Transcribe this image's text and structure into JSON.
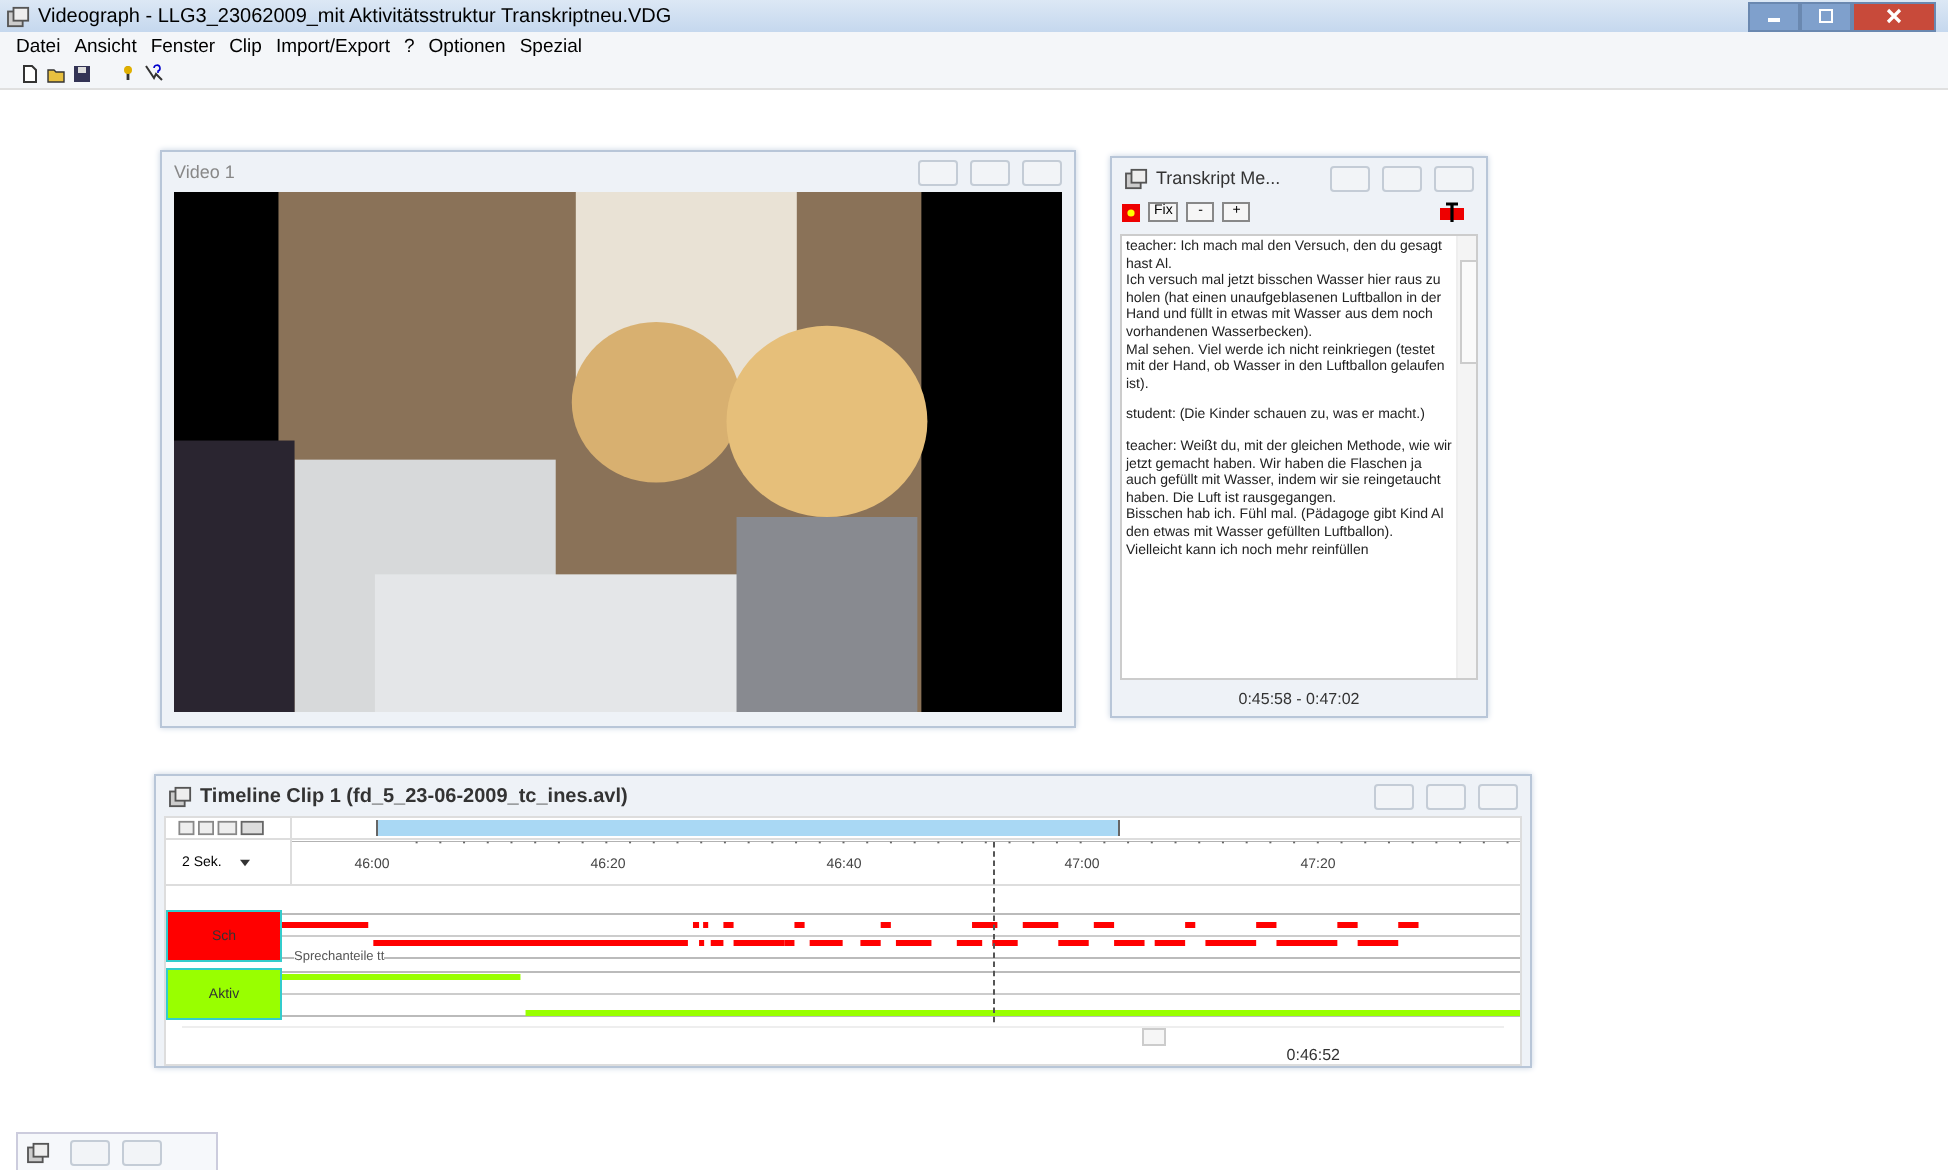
{
  "window": {
    "title": "Videograph - LLG3_23062009_mit Aktivitätsstruktur Transkriptneu.VDG"
  },
  "menu": [
    "Datei",
    "Ansicht",
    "Fenster",
    "Clip",
    "Import/Export",
    "?",
    "Optionen",
    "Spezial"
  ],
  "video_window": {
    "title": "Video 1"
  },
  "transcript_window": {
    "title": "Transkript Me...",
    "fix_button": "Fix",
    "minus_button": "-",
    "plus_button": "+",
    "paragraphs": [
      "teacher: Ich mach mal den Versuch, den du gesagt hast Al.\nIch versuch mal jetzt bisschen Wasser hier raus zu holen (hat einen unaufgeblasenen Luftballon in der Hand und füllt in etwas mit Wasser aus dem noch vorhandenen Wasserbecken).\nMal sehen. Viel werde ich nicht reinkriegen (testet mit der Hand, ob Wasser in den Luftballon gelaufen ist).",
      "student: (Die Kinder schauen zu, was er macht.)",
      "teacher: Weißt du, mit der gleichen Methode, wie wir jetzt gemacht haben. Wir haben die Flaschen ja auch gefüllt mit Wasser, indem wir sie reingetaucht haben. Die Luft ist rausgegangen.\nBisschen hab ich. Fühl mal. (Pädagoge gibt Kind Al den etwas mit Wasser gefüllten Luftballon).\nVielleicht kann ich noch mehr reinfüllen"
    ],
    "time_range": "0:45:58 - 0:47:02"
  },
  "timeline_window": {
    "title": "Timeline Clip 1 (fd_5_23-06-2009_tc_ines.avl)",
    "zoom": "2 Sek.",
    "ticks": [
      "46:00",
      "46:20",
      "46:40",
      "47:00",
      "47:20"
    ],
    "tracks": [
      {
        "label": "Sch",
        "color": "#ff0000",
        "sublabel": "Sprechanteile tt"
      },
      {
        "label": "Aktiv",
        "color": "#99ff00"
      }
    ],
    "current_time": "0:46:52"
  }
}
